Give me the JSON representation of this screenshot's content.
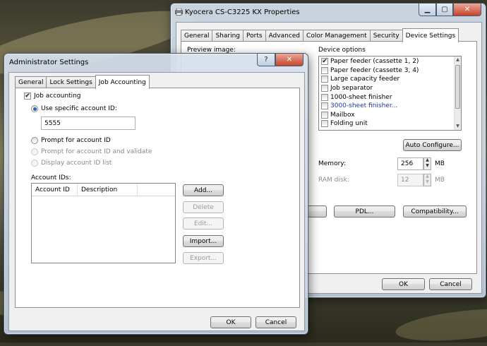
{
  "bg_window": {
    "title": "Kyocera CS-C3225 KX Properties",
    "tabs": [
      "General",
      "Sharing",
      "Ports",
      "Advanced",
      "Color Management",
      "Security",
      "Device Settings"
    ],
    "preview_label": "Preview image:",
    "device_options_label": "Device options",
    "device_options": [
      {
        "label": "Paper feeder (cassette 1, 2)",
        "checked": true
      },
      {
        "label": "Paper feeder (cassette 3, 4)",
        "checked": false
      },
      {
        "label": "Large capacity feeder",
        "checked": false
      },
      {
        "label": "Job separator",
        "checked": false
      },
      {
        "label": "1000-sheet finisher",
        "checked": false
      },
      {
        "label": "3000-sheet finisher...",
        "checked": false
      },
      {
        "label": "Mailbox",
        "checked": false
      },
      {
        "label": "Folding unit",
        "checked": false
      }
    ],
    "auto_configure": "Auto Configure...",
    "memory_label": "Memory:",
    "memory_value": "256",
    "memory_unit": "MB",
    "ramdisk_label": "RAM disk:",
    "ramdisk_value": "12",
    "ramdisk_unit": "MB",
    "pdl_button": "PDL...",
    "compat_button": "Compatibility...",
    "ok": "OK",
    "cancel": "Cancel"
  },
  "dialog": {
    "title": "Administrator Settings",
    "help": "?",
    "tabs": [
      "General",
      "Lock Settings",
      "Job Accounting"
    ],
    "job_accounting": "Job accounting",
    "use_specific": "Use specific account ID:",
    "account_id_value": "5555",
    "prompt_for_id": "Prompt for account ID",
    "prompt_validate": "Prompt for account ID and validate",
    "display_list": "Display account ID list",
    "account_ids_label": "Account IDs:",
    "columns": [
      "Account ID",
      "Description"
    ],
    "buttons": {
      "add": "Add...",
      "delete": "Delete",
      "edit": "Edit...",
      "import": "Import...",
      "export": "Export..."
    },
    "ok": "OK",
    "cancel": "Cancel"
  },
  "icons": {
    "printer": "printer-icon",
    "minimize": "minimize-icon",
    "maximize": "maximize-icon",
    "close": "close-icon",
    "check": "check-icon"
  }
}
